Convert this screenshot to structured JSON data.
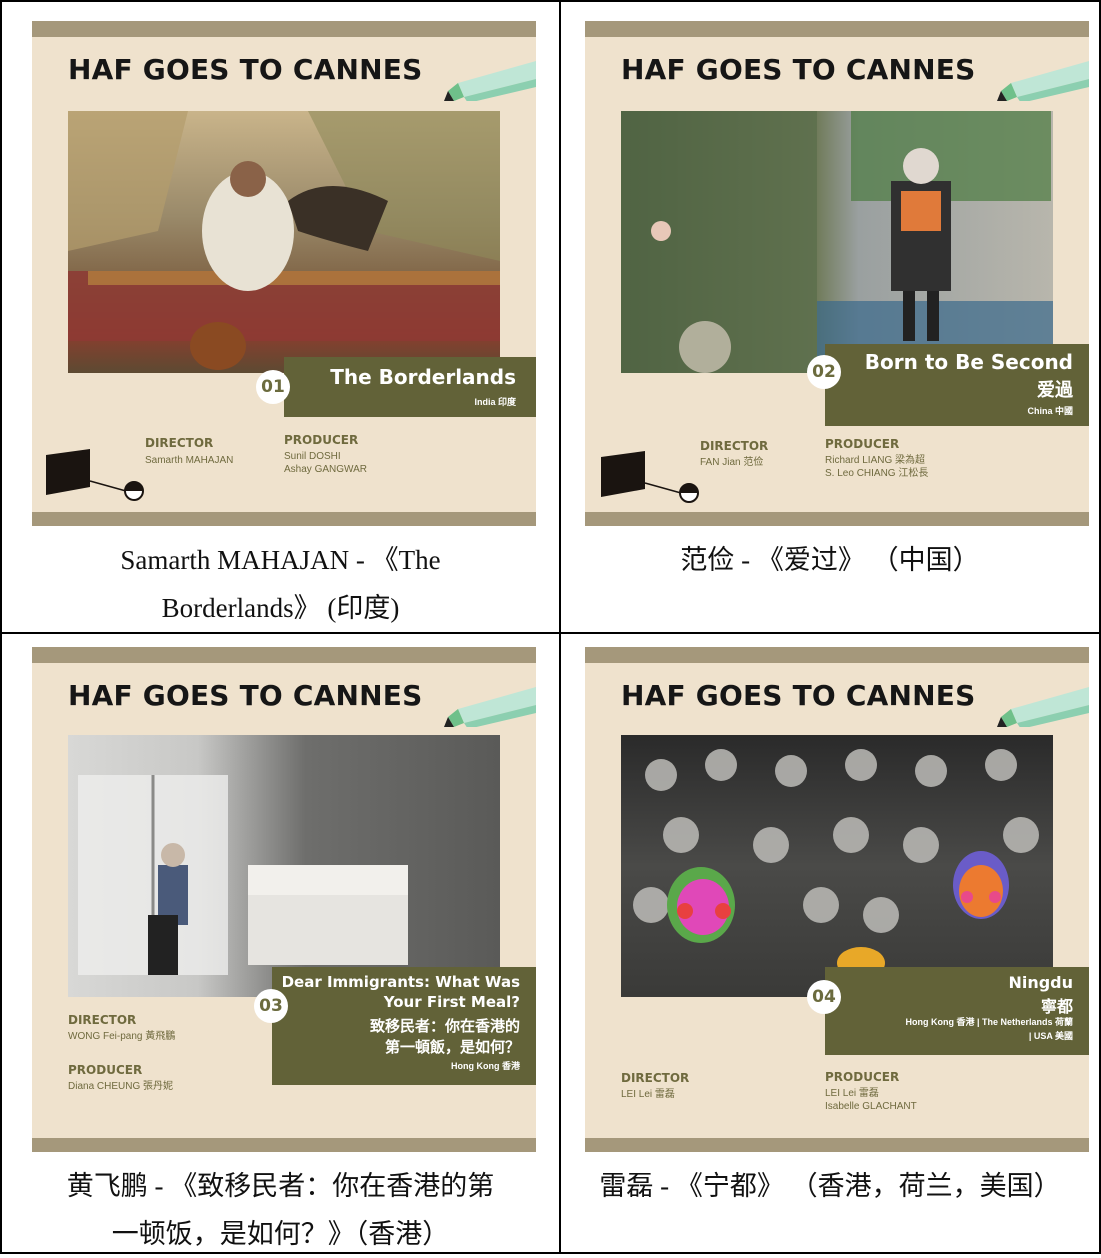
{
  "posters": [
    {
      "header": "HAF GOES TO CANNES",
      "number": "01",
      "title_lines": [
        "The Borderlands"
      ],
      "country": "India 印度",
      "director_label": "DIRECTOR",
      "director": [
        "Samarth MAHAJAN"
      ],
      "producer_label": "PRODUCER",
      "producer": [
        "Sunil DOSHI",
        "Ashay GANGWAR"
      ]
    },
    {
      "header": "HAF GOES TO CANNES",
      "number": "02",
      "title_lines": [
        "Born to Be Second",
        "爱過"
      ],
      "country": "China 中國",
      "director_label": "DIRECTOR",
      "director": [
        "FAN Jian 范俭"
      ],
      "producer_label": "PRODUCER",
      "producer": [
        "Richard LIANG 梁為超",
        "S. Leo CHIANG 江松長"
      ]
    },
    {
      "header": "HAF GOES TO CANNES",
      "number": "03",
      "title_lines": [
        "Dear Immigrants: What Was",
        "Your First Meal?",
        "致移民者：你在香港的",
        "第一頓飯，是如何？"
      ],
      "country": "Hong Kong 香港",
      "director_label": "DIRECTOR",
      "director": [
        "WONG Fei-pang 黃飛鵬"
      ],
      "producer_label": "PRODUCER",
      "producer": [
        "Diana CHEUNG 張丹妮"
      ]
    },
    {
      "header": "HAF GOES TO CANNES",
      "number": "04",
      "title_lines": [
        "Ningdu",
        "寧都"
      ],
      "country_lines": [
        "Hong Kong 香港 | The Netherlands 荷蘭",
        "| USA 美國"
      ],
      "director_label": "DIRECTOR",
      "director": [
        "LEI Lei 雷磊"
      ],
      "producer_label": "PRODUCER",
      "producer": [
        "LEI Lei 雷磊",
        "Isabelle GLACHANT"
      ]
    }
  ],
  "captions": [
    [
      "Samarth MAHAJAN - 《The",
      "Borderlands》 (印度)"
    ],
    [
      "范俭 - 《爱过》 （中国）"
    ],
    [
      "黄飞鹏 - 《致移民者：你在香港的第",
      "一顿饭，是如何？》（香港）"
    ],
    [
      "雷磊 - 《宁都》 （香港，荷兰，美国）"
    ]
  ],
  "colors": {
    "poster_bg": "#efe2cd",
    "band": "#a5987b",
    "tag": "#626238",
    "role_text": "#6f6a3e"
  }
}
